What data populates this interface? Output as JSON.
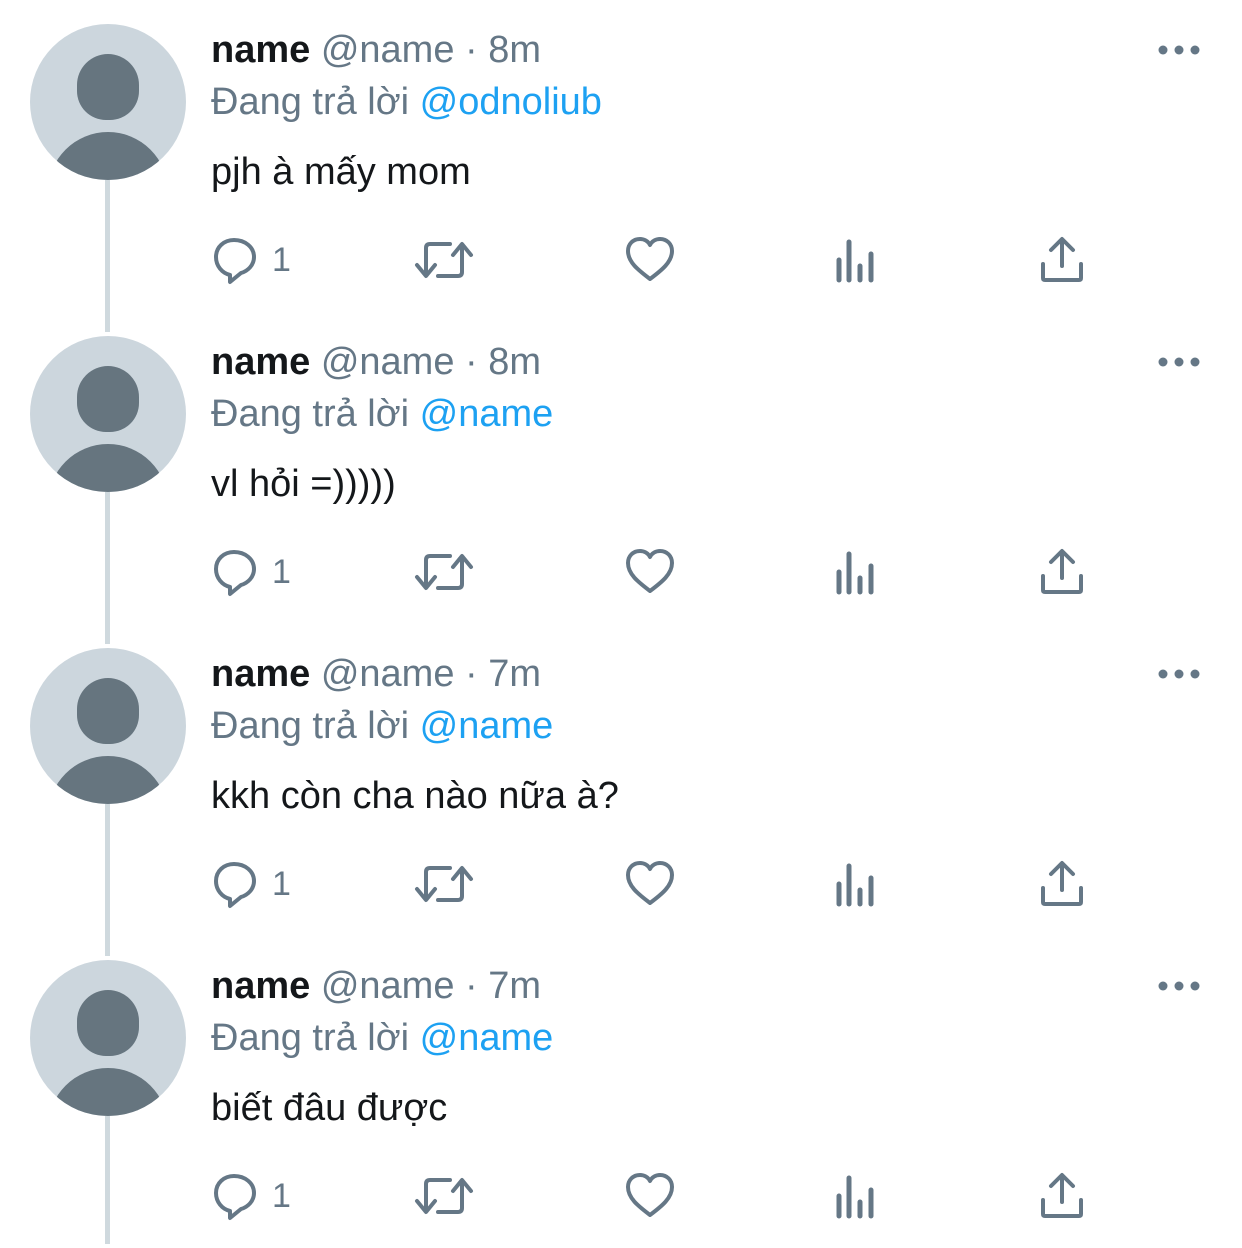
{
  "tweets": [
    {
      "display_name": "name",
      "handle": "@name",
      "separator": "·",
      "time": "8m",
      "reply_prefix": "Đang trả lời",
      "reply_to": "@odnoliub",
      "text": "pjh à mấy mom",
      "reply_count": "1"
    },
    {
      "display_name": "name",
      "handle": "@name",
      "separator": "·",
      "time": "8m",
      "reply_prefix": "Đang trả lời",
      "reply_to": "@name",
      "text": "vl hỏi =)))))",
      "reply_count": "1"
    },
    {
      "display_name": "name",
      "handle": "@name",
      "separator": "·",
      "time": "7m",
      "reply_prefix": "Đang trả lời",
      "reply_to": "@name",
      "text": "kkh còn cha nào nữa à?",
      "reply_count": "1"
    },
    {
      "display_name": "name",
      "handle": "@name",
      "separator": "·",
      "time": "7m",
      "reply_prefix": "Đang trả lời",
      "reply_to": "@name",
      "text": "biết đâu được",
      "reply_count": "1"
    }
  ],
  "icons": {
    "avatar": "default-avatar-icon",
    "more": "more-dots-icon",
    "reply": "reply-bubble-icon",
    "retweet": "retweet-icon",
    "like": "heart-icon",
    "analytics": "analytics-bars-icon",
    "share": "share-upload-icon"
  },
  "colors": {
    "text_primary": "#14171a",
    "text_secondary": "#657786",
    "link": "#1da1f2",
    "thread_line": "#cfd9de",
    "avatar_bg": "#ccd6dd",
    "avatar_fg": "#66757f"
  }
}
